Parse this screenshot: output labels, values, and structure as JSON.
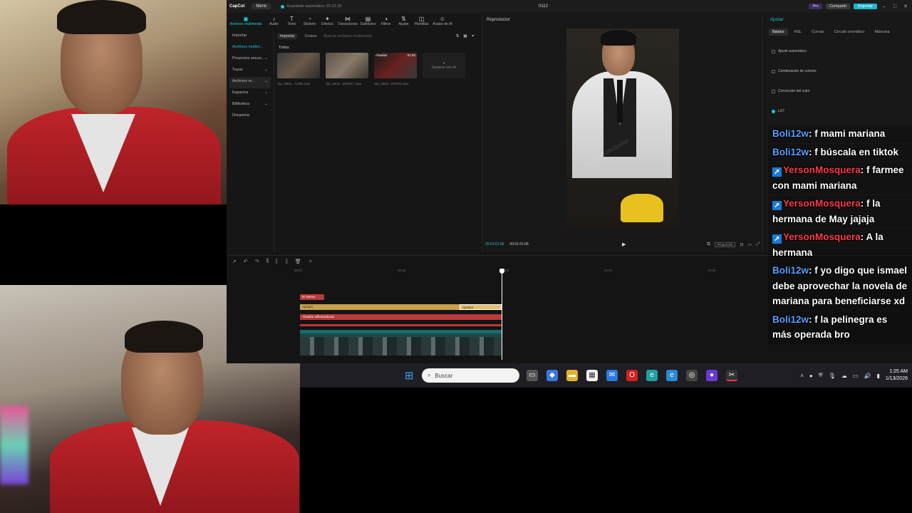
{
  "app": {
    "brand": "CapCut",
    "menu_label": "Menú",
    "autosave_text": "Guardado automático: 01:21:32",
    "project_name": "0112",
    "pro_label": "Pro",
    "share_label": "Compartir",
    "export_label": "Exportar"
  },
  "toolbar": {
    "items": [
      {
        "label": "Archivos multimedia",
        "icon": "media-icon"
      },
      {
        "label": "Audio",
        "icon": "audio-icon"
      },
      {
        "label": "Texto",
        "icon": "text-icon"
      },
      {
        "label": "Stickers",
        "icon": "sticker-icon"
      },
      {
        "label": "Efectos",
        "icon": "effects-icon"
      },
      {
        "label": "Transiciones",
        "icon": "transition-icon"
      },
      {
        "label": "Subtítulos",
        "icon": "subtitle-icon"
      },
      {
        "label": "Filtros",
        "icon": "filter-icon"
      },
      {
        "label": "Ajuste",
        "icon": "adjust-icon"
      },
      {
        "label": "Plantillas",
        "icon": "template-icon"
      },
      {
        "label": "Avatar de IA",
        "icon": "avatar-icon"
      }
    ]
  },
  "sidebar": {
    "items": [
      {
        "label": "Importar"
      },
      {
        "label": "Archivos multim..."
      },
      {
        "label": "Proyectos secun..."
      },
      {
        "label": "Tuyos"
      },
      {
        "label": "Archivos m..."
      },
      {
        "label": "Espacios"
      },
      {
        "label": "Biblioteca"
      },
      {
        "label": "Dreamina"
      }
    ]
  },
  "media": {
    "import_label": "Importar",
    "record_label": "Grabar",
    "search_placeholder": "Buscar archivos multimedia",
    "section_label": "Todos",
    "clips": [
      {
        "name": "clip_09KE...72d92.mp4",
        "badge": "",
        "duration": ""
      },
      {
        "name": "clip_09KE...MDSD7.mp4",
        "badge": "",
        "duration": ""
      },
      {
        "name": "clip_09KE...8F63Xr.mp4",
        "badge": "Añadido",
        "duration": "01:02"
      }
    ],
    "generate_label": "Generar con IA"
  },
  "player": {
    "title": "Reproductor",
    "current_time": "00:01:01:06",
    "total_time": "00:01:01:06",
    "ratio_label": "Proporción",
    "watermark": "Youtube NiñoSuebo"
  },
  "adjust_panel": {
    "title": "Ajustar",
    "tabs": [
      "Básico",
      "HSL",
      "Curvas",
      "Círculo cromático",
      "Máscara"
    ],
    "rows": [
      {
        "label": "Ajuste automático"
      },
      {
        "label": "Combinación de colores"
      },
      {
        "label": "Corrección del color"
      },
      {
        "label": "LUT"
      }
    ]
  },
  "timeline": {
    "ruler": [
      "00:00",
      "00:30",
      "01:00",
      "01:30",
      "02:00"
    ],
    "tracks": {
      "title_clip": "Ni Nuevo",
      "gold_clip": "Ajuste2",
      "gold_seg": "Ajuste3",
      "red_clip": "Youtube NiñoSuebo16",
      "main_clip_label": "clip_09KE7BFSFCD4ZVK6AT6RPD3I.mp4"
    }
  },
  "chat": {
    "messages": [
      {
        "user": "Boli12w",
        "text": ": f mami mariana",
        "user_type": "boli"
      },
      {
        "user": "Boli12w",
        "text": ": f búscala en tiktok",
        "user_type": "boli"
      },
      {
        "user": "YersonMosquera",
        "text": ": f farmee con mami mariana",
        "user_type": "yerson"
      },
      {
        "user": "YersonMosquera",
        "text": ": f la hermana de May jajaja",
        "user_type": "yerson"
      },
      {
        "user": "YersonMosquera",
        "text": ": A la hermana",
        "user_type": "yerson"
      },
      {
        "user": "Boli12w",
        "text": ": f yo digo que ismael debe aprovechar la novela de mariana para beneficiarse xd",
        "user_type": "boli"
      },
      {
        "user": "Boli12w",
        "text": ": f la pelinegra es más operada bro",
        "user_type": "boli"
      }
    ]
  },
  "taskbar": {
    "search_placeholder": "Buscar",
    "time": "1:25 AM",
    "date": "1/13/2026"
  }
}
